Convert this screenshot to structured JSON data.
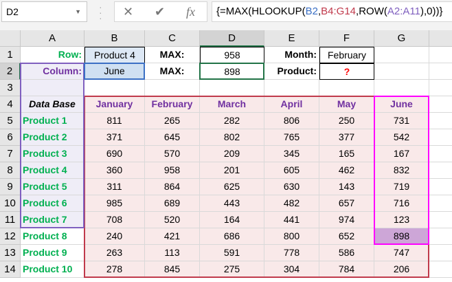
{
  "formula_bar": {
    "name_box": "D2",
    "cancel_icon": "x-icon",
    "enter_icon": "check-icon",
    "fx_label": "fx",
    "formula_parts": [
      {
        "t": "{=MAX(HLOOKUP(",
        "c": "#000000"
      },
      {
        "t": "B2",
        "c": "#3a6fc4"
      },
      {
        "t": ",",
        "c": "#000000"
      },
      {
        "t": "B4:G14",
        "c": "#c0394b"
      },
      {
        "t": ",ROW(",
        "c": "#000000"
      },
      {
        "t": "A2:A11",
        "c": "#7f5fbf"
      },
      {
        "t": "),0))}",
        "c": "#000000"
      }
    ]
  },
  "columns": [
    "A",
    "B",
    "C",
    "D",
    "E",
    "F",
    "G"
  ],
  "active_cell": "D2",
  "colors": {
    "green": "#00b050",
    "purple": "#7030a0",
    "red": "#ff0000",
    "range_fill": "#f9e9e9",
    "lavender": "#efedf7",
    "blue_fill": "#dde8f5",
    "highlight": "#cda6d7",
    "magenta": "#ff00ff",
    "range_border": "#c0394b"
  },
  "top": {
    "row_label": "Row:",
    "row_value": "Product 4",
    "column_label": "Column:",
    "column_value": "June",
    "max1_label": "MAX:",
    "max1_value": "958",
    "max2_label": "MAX:",
    "max2_value": "898",
    "month_label": "Month:",
    "month_value": "February",
    "product_label": "Product:",
    "product_value": "?"
  },
  "table": {
    "corner": "Data Base",
    "headers": [
      "January",
      "February",
      "March",
      "April",
      "May",
      "June"
    ],
    "rows": [
      {
        "name": "Product 1",
        "values": [
          "811",
          "265",
          "282",
          "806",
          "250",
          "731"
        ]
      },
      {
        "name": "Product 2",
        "values": [
          "371",
          "645",
          "802",
          "765",
          "377",
          "542"
        ]
      },
      {
        "name": "Product 3",
        "values": [
          "690",
          "570",
          "209",
          "345",
          "165",
          "167"
        ]
      },
      {
        "name": "Product 4",
        "values": [
          "360",
          "958",
          "201",
          "605",
          "462",
          "832"
        ]
      },
      {
        "name": "Product 5",
        "values": [
          "311",
          "864",
          "625",
          "630",
          "143",
          "719"
        ]
      },
      {
        "name": "Product 6",
        "values": [
          "985",
          "689",
          "443",
          "482",
          "657",
          "716"
        ]
      },
      {
        "name": "Product 7",
        "values": [
          "708",
          "520",
          "164",
          "441",
          "974",
          "123"
        ]
      },
      {
        "name": "Product 8",
        "values": [
          "240",
          "421",
          "686",
          "800",
          "652",
          "898"
        ]
      },
      {
        "name": "Product 9",
        "values": [
          "263",
          "113",
          "591",
          "778",
          "586",
          "747"
        ]
      },
      {
        "name": "Product 10",
        "values": [
          "278",
          "845",
          "275",
          "304",
          "784",
          "206"
        ]
      }
    ]
  }
}
